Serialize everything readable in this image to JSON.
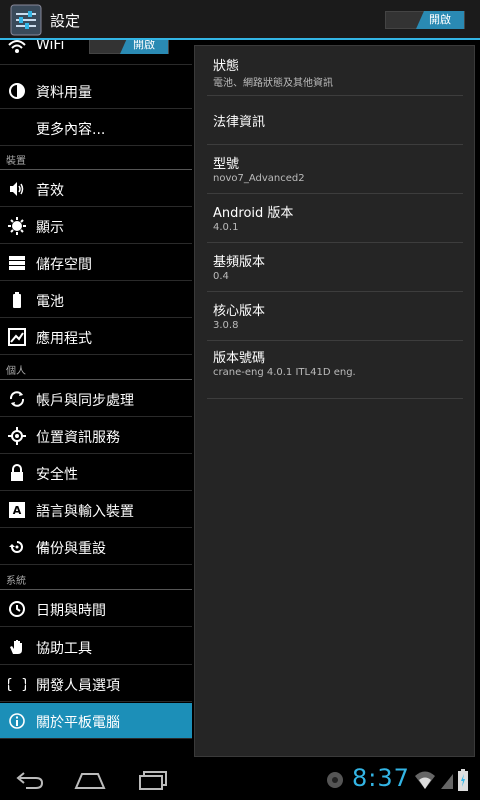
{
  "header": {
    "title": "設定",
    "toggle_label": "開啟"
  },
  "sidebar": {
    "wifi": {
      "label": "WiFi",
      "toggle_label": "開啟"
    },
    "items": [
      {
        "label": "資料用量",
        "icon": "data-usage-icon"
      },
      {
        "label": "更多內容...",
        "icon": ""
      }
    ],
    "sections": [
      {
        "title": "裝置",
        "items": [
          {
            "label": "音效",
            "icon": "volume-icon"
          },
          {
            "label": "顯示",
            "icon": "brightness-icon"
          },
          {
            "label": "儲存空間",
            "icon": "storage-icon"
          },
          {
            "label": "電池",
            "icon": "battery-icon"
          },
          {
            "label": "應用程式",
            "icon": "apps-icon"
          }
        ]
      },
      {
        "title": "個人",
        "items": [
          {
            "label": "帳戶與同步處理",
            "icon": "sync-icon"
          },
          {
            "label": "位置資訊服務",
            "icon": "location-icon"
          },
          {
            "label": "安全性",
            "icon": "lock-icon"
          },
          {
            "label": "語言與輸入裝置",
            "icon": "keyboard-icon"
          },
          {
            "label": "備份與重設",
            "icon": "backup-icon"
          }
        ]
      },
      {
        "title": "系統",
        "items": [
          {
            "label": "日期與時間",
            "icon": "clock-icon"
          },
          {
            "label": "協助工具",
            "icon": "hand-icon"
          },
          {
            "label": "開發人員選項",
            "icon": "braces-icon"
          },
          {
            "label": "關於平板電腦",
            "icon": "info-icon",
            "selected": true
          }
        ]
      }
    ]
  },
  "detail": {
    "items": [
      {
        "title": "狀態",
        "subtitle": "電池、網路狀態及其他資訊"
      },
      {
        "title": "法律資訊",
        "subtitle": ""
      },
      {
        "title": "型號",
        "subtitle": "novo7_Advanced2"
      },
      {
        "title": "Android 版本",
        "subtitle": "4.0.1"
      },
      {
        "title": "基頻版本",
        "subtitle": "0.4"
      },
      {
        "title": "核心版本",
        "subtitle": "3.0.8"
      },
      {
        "title": "版本號碼",
        "subtitle": "crane-eng 4.0.1 ITL41D eng."
      }
    ]
  },
  "statusbar": {
    "time": "8:37"
  },
  "colors": {
    "accent": "#33b5e5",
    "selected": "#1c8fb8",
    "toggle_on": "#2a8ab3",
    "panel": "#252525"
  }
}
